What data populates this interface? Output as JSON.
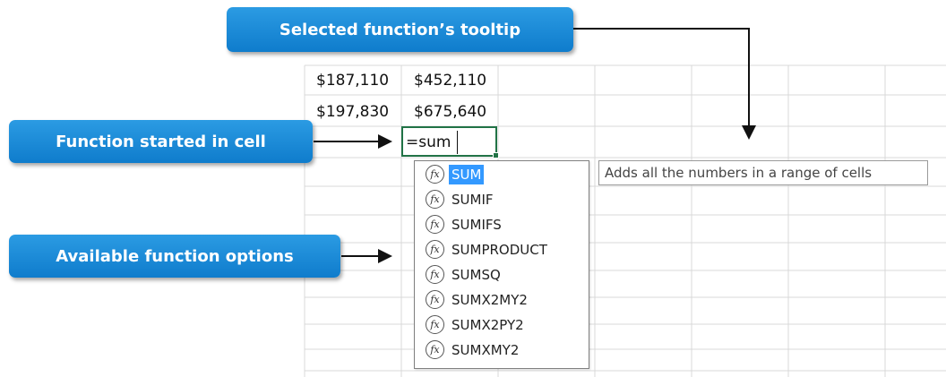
{
  "spreadsheet": {
    "rows": [
      [
        "$187,110",
        "$452,110"
      ],
      [
        "$197,830",
        "$675,640"
      ]
    ],
    "active_cell_text": "=sum"
  },
  "autocomplete": {
    "icon": "function-icon",
    "icon_glyph": "fx",
    "selected_index": 0,
    "items": [
      "SUM",
      "SUMIF",
      "SUMIFS",
      "SUMPRODUCT",
      "SUMSQ",
      "SUMX2MY2",
      "SUMX2PY2",
      "SUMXMY2"
    ]
  },
  "tooltip": {
    "text": "Adds all the numbers in a range of cells"
  },
  "callouts": {
    "tooltip_label": "Selected function’s  tooltip",
    "cell_label": "Function started in cell",
    "options_label": "Available  function  options"
  },
  "colors": {
    "callout_blue": "#1a8ad9",
    "selection_blue": "#3399ff",
    "active_cell_border": "#217346"
  }
}
